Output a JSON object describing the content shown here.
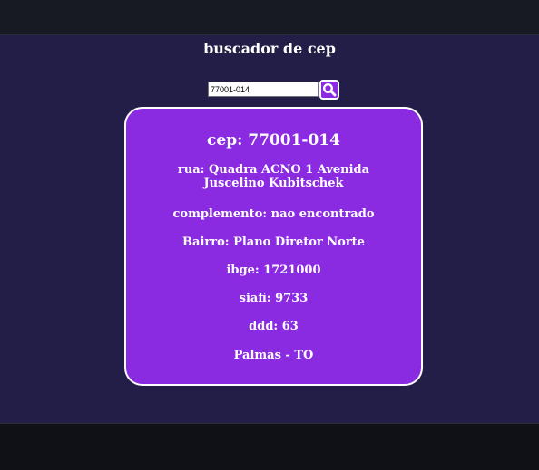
{
  "page": {
    "title": "buscador de cep"
  },
  "search": {
    "value": "77001-014",
    "button_icon": "search-icon"
  },
  "result": {
    "cep": "cep: 77001-014",
    "rua": "rua: Quadra ACNO 1 Avenida Juscelino Kubitschek",
    "complemento": "complemento: nao encontrado",
    "bairro": "Bairro: Plano Diretor Norte",
    "ibge": "ibge: 1721000",
    "siafi": "siafi: 9733",
    "ddd": "ddd: 63",
    "cidade": "Palmas - TO"
  },
  "colors": {
    "page_background": "#231e48",
    "card_background": "#8a2be2",
    "top_bar": "#171a22",
    "bottom_bar": "#0f1117",
    "text": "#ffffff"
  }
}
